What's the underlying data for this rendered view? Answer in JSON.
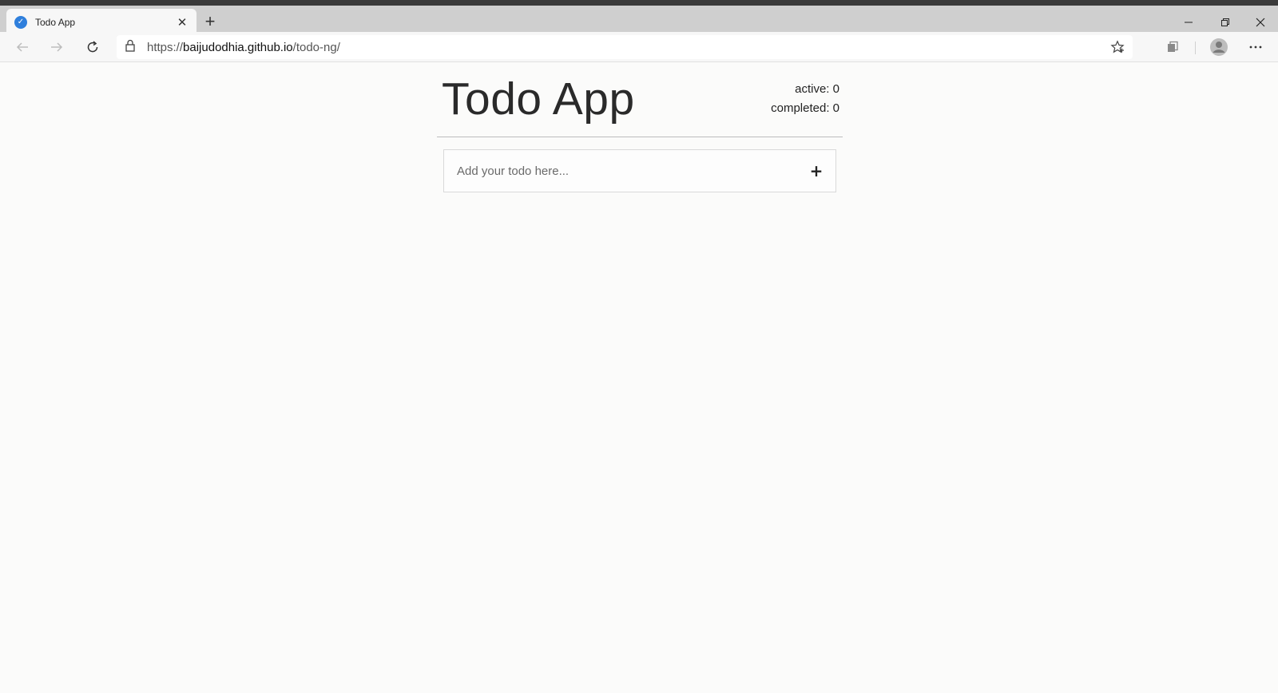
{
  "browser": {
    "tab": {
      "title": "Todo App"
    },
    "address": {
      "scheme": "https://",
      "host": "baijudodhia.github.io",
      "path": "/todo-ng/"
    }
  },
  "app": {
    "title": "Todo App",
    "stats": {
      "active": "active: 0",
      "completed": "completed: 0"
    },
    "input": {
      "placeholder": "Add your todo here...",
      "value": ""
    },
    "add_button": "+"
  },
  "colors": {
    "favicon": "#2f7fdc",
    "page_background": "#fbfbfa"
  },
  "icons": [
    "todo-favicon-icon",
    "close-icon",
    "plus-icon",
    "minimize-icon",
    "restore-icon",
    "back-icon",
    "forward-icon",
    "refresh-icon",
    "lock-icon",
    "favorite-star-icon",
    "collections-icon",
    "profile-avatar-icon",
    "more-options-icon"
  ]
}
